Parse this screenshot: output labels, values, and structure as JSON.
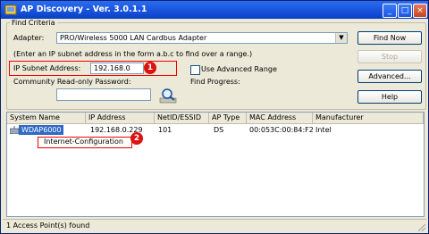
{
  "window": {
    "title": "AP Discovery - Ver. 3.0.1.1",
    "controls": {
      "minimize": "_",
      "maximize": "□",
      "close": "×"
    }
  },
  "criteria": {
    "legend": "Find Criteria",
    "adapter_label": "Adapter:",
    "adapter_value": "PRO/Wireless 5000 LAN Cardbus Adapter",
    "hint": "(Enter an IP subnet address in the form a.b.c to find over a range.)",
    "subnet_label": "IP Subnet Address:",
    "subnet_value": "192.168.0",
    "advanced_range_label": "Use Advanced Range",
    "community_label": "Community Read-only Password:",
    "community_value": "",
    "progress_label": "Find Progress:"
  },
  "buttons": {
    "find_now": "Find Now",
    "stop": "Stop",
    "advanced": "Advanced...",
    "help": "Help"
  },
  "annotations": {
    "badge1": "1",
    "badge2": "2"
  },
  "list": {
    "columns": [
      "System Name",
      "IP Address",
      "NetID/ESSID",
      "AP Type",
      "MAC Address",
      "Manufacturer"
    ],
    "rows": [
      {
        "system_name": "WDAP6000",
        "ip": "192.168.0.229",
        "netid": "101",
        "ap_type": "DS",
        "mac": "00:053C:00:84:F2",
        "manufacturer": "Intel"
      }
    ],
    "context_menu_item": "Internet-Configuration"
  },
  "status": {
    "text": "1 Access Point(s) found"
  },
  "colors": {
    "accent": "#e00000",
    "titlebar": "#0a3fc7",
    "selection": "#316ac5"
  }
}
